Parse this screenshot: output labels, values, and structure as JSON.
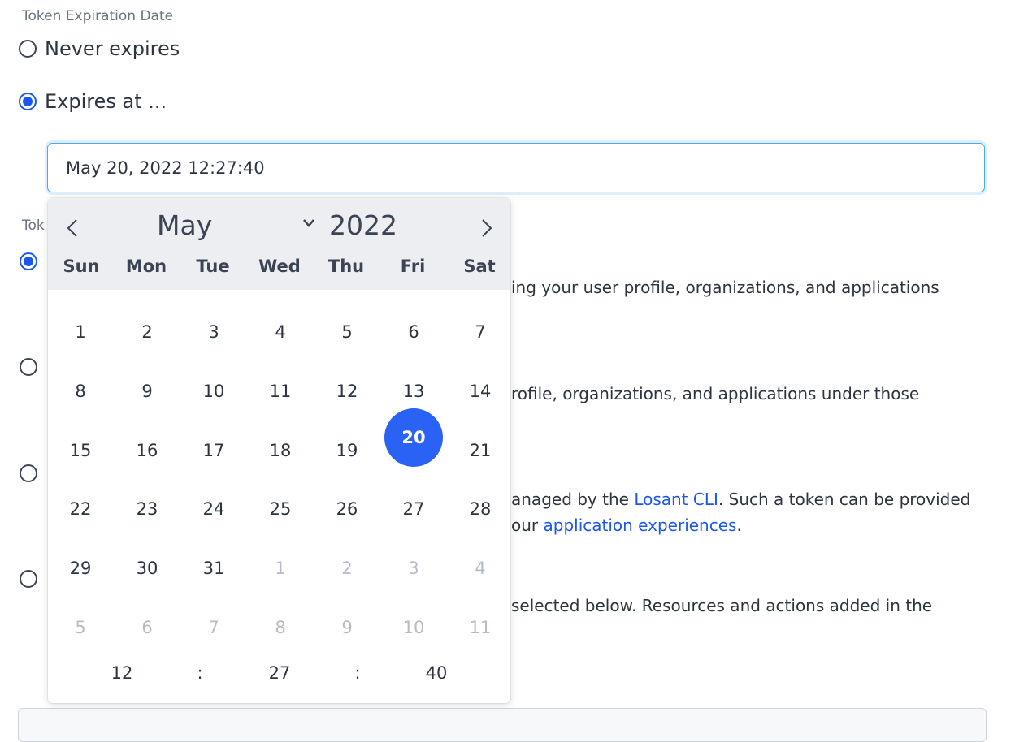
{
  "expiration": {
    "label": "Token Expiration Date",
    "option_never": "Never expires",
    "option_expires_at": "Expires at ...",
    "date_value": "May 20, 2022 12:27:40"
  },
  "token_type": {
    "label_partial": "Tok",
    "line1": "ing your user profile, organizations, and applications",
    "line2": "rofile, organizations, and applications under those",
    "line3_pre": "anaged by the ",
    "line3_link": "Losant CLI",
    "line3_post": ". Such a token can be provided",
    "line4_pre": "our ",
    "line4_link": "application experiences",
    "line4_post": ".",
    "line5": "selected below. Resources and actions added in the"
  },
  "calendar": {
    "month": "May",
    "year": "2022",
    "weekdays": [
      "Sun",
      "Mon",
      "Tue",
      "Wed",
      "Thu",
      "Fri",
      "Sat"
    ],
    "weeks": [
      [
        "1",
        "2",
        "3",
        "4",
        "5",
        "6",
        "7"
      ],
      [
        "8",
        "9",
        "10",
        "11",
        "12",
        "13",
        "14"
      ],
      [
        "15",
        "16",
        "17",
        "18",
        "19",
        "20",
        "21"
      ],
      [
        "22",
        "23",
        "24",
        "25",
        "26",
        "27",
        "28"
      ],
      [
        "29",
        "30",
        "31",
        "1",
        "2",
        "3",
        "4"
      ],
      [
        "5",
        "6",
        "7",
        "8",
        "9",
        "10",
        "11"
      ]
    ],
    "selected_day": "20",
    "time": {
      "hour": "12",
      "minute": "27",
      "second": "40",
      "separator": ":"
    }
  },
  "colors": {
    "accent": "#2962f5",
    "link": "#1a56f0"
  }
}
